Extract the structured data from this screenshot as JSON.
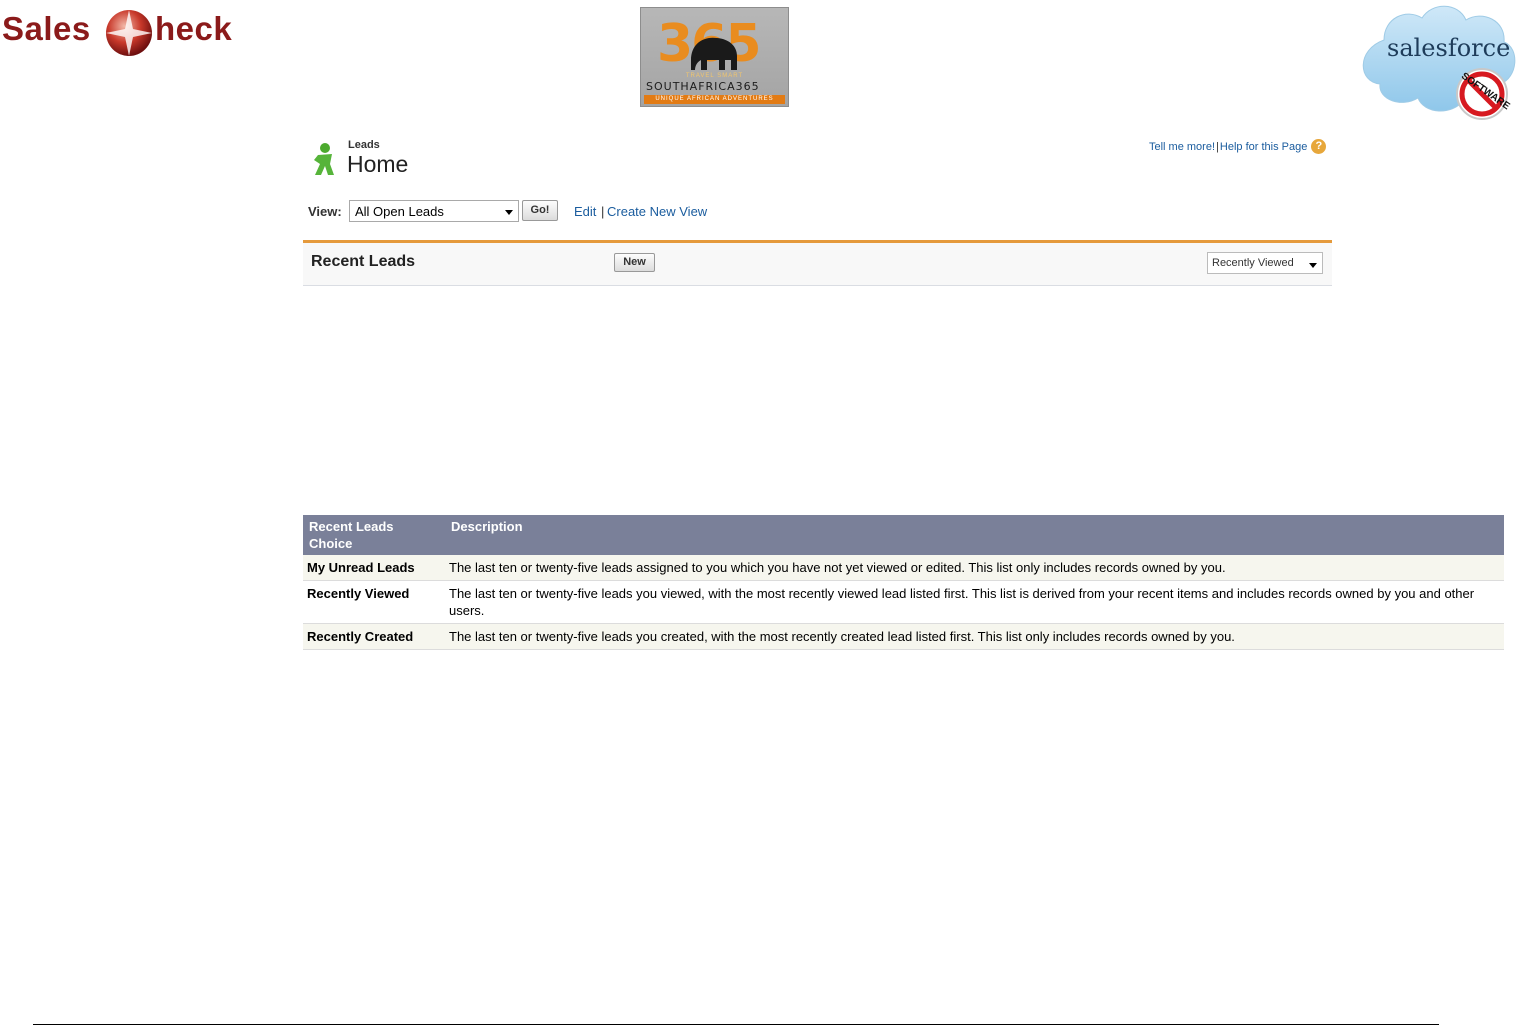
{
  "logos": {
    "salescheck": {
      "part1": "Sales",
      "part2": "heck"
    },
    "southafrica365": {
      "digits": "365",
      "tagline_top": "TRAVEL SMART",
      "name": "SOUTHAFRICA365",
      "tagline_bottom": "UNIQUE AFRICAN ADVENTURES"
    },
    "salesforce": {
      "wordmark": "salesforce",
      "stamp": "SOFTWARE"
    }
  },
  "header": {
    "breadcrumb": "Leads",
    "title": "Home",
    "help_link_1": "Tell me more!",
    "help_separator": "|",
    "help_link_2": "Help for this Page",
    "help_icon_glyph": "?"
  },
  "view_row": {
    "label": "View:",
    "selected": "All Open Leads",
    "go_label": "Go!",
    "edit_label": "Edit",
    "separator": "|",
    "create_label": "Create New View"
  },
  "recent_panel": {
    "title": "Recent Leads",
    "new_label": "New",
    "filter_selected": "Recently Viewed"
  },
  "table": {
    "headers": [
      "Recent Leads Choice",
      "Description"
    ],
    "rows": [
      {
        "choice": "My Unread Leads",
        "description": "The last ten or twenty-five leads assigned to you which you have not yet viewed or edited. This list only includes records owned by you."
      },
      {
        "choice": "Recently Viewed",
        "description": "The last ten or twenty-five leads you viewed, with the most recently viewed lead listed first. This list is derived from your recent items and includes records owned by you and other users."
      },
      {
        "choice": "Recently Created",
        "description": "The last ten or twenty-five leads you created, with the most recently created lead listed first. This list only includes records owned by you."
      }
    ]
  },
  "colors": {
    "brand_red": "#8b1a1a",
    "link_blue": "#1a5c9e",
    "panel_accent": "#e59a3c",
    "table_header": "#7a8099"
  }
}
